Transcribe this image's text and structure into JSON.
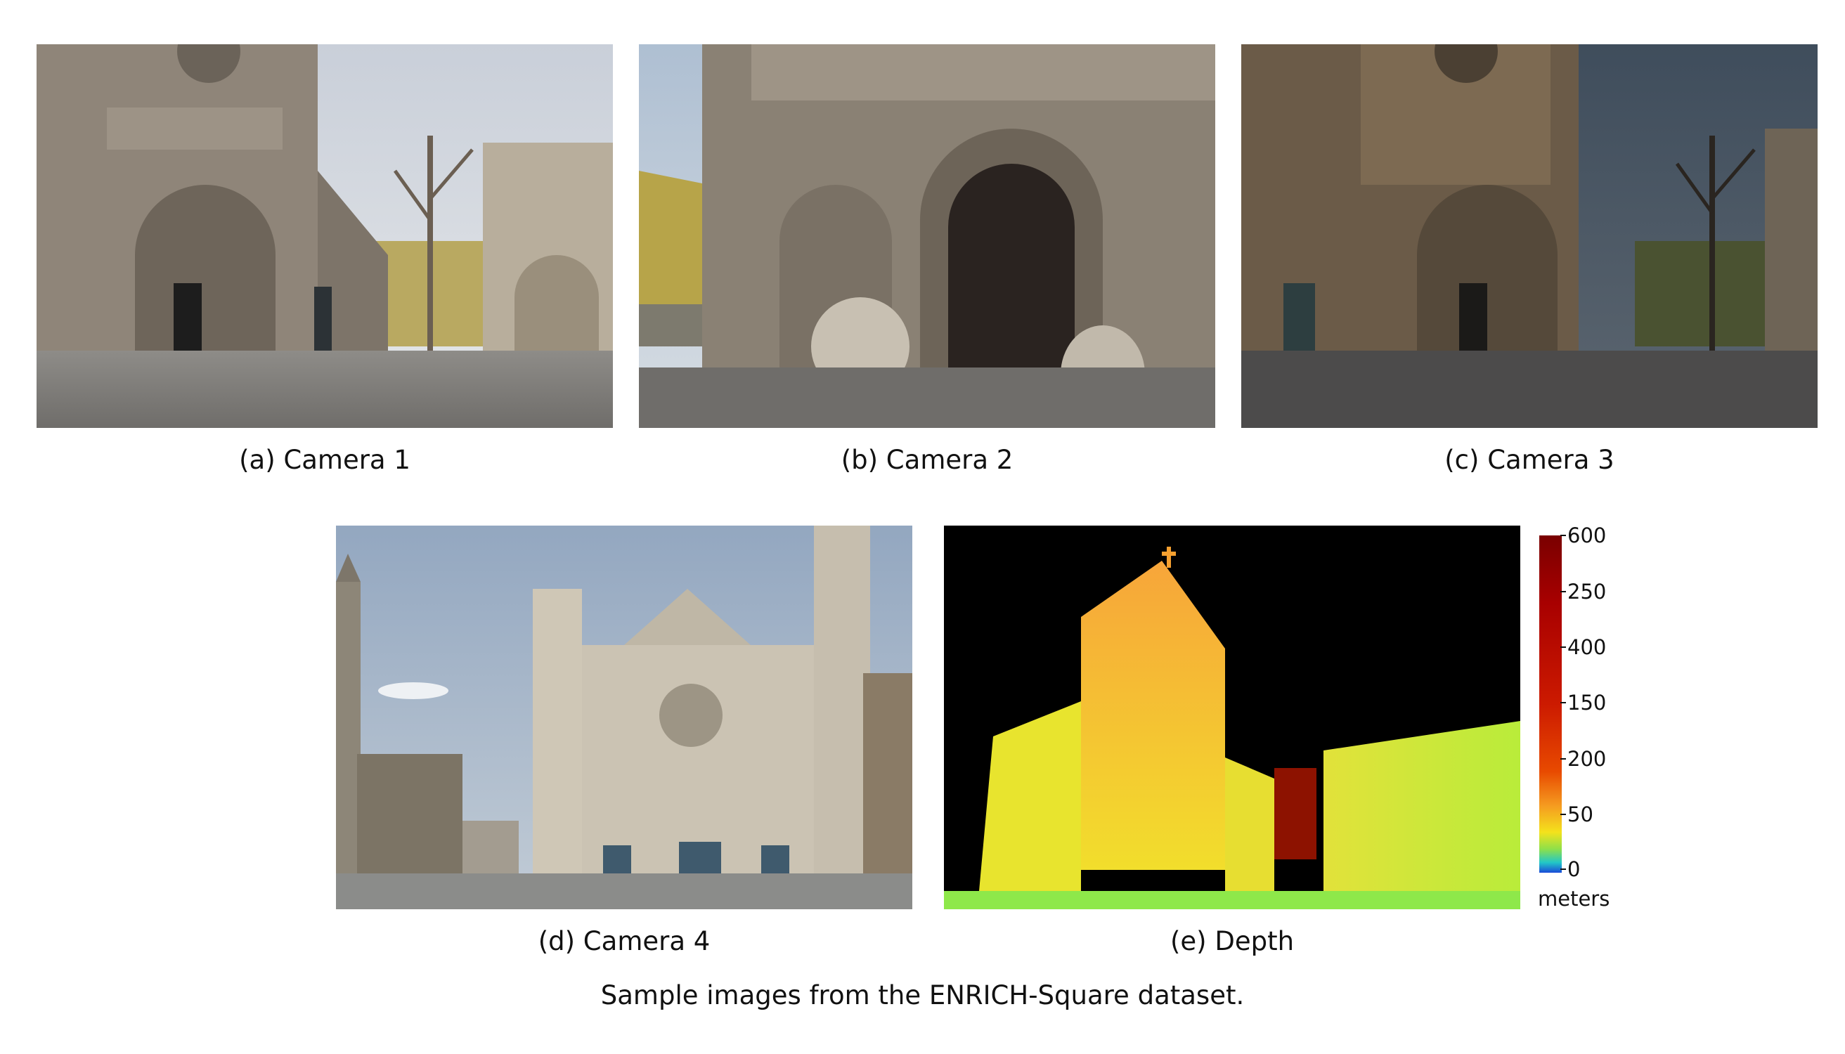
{
  "panels": [
    {
      "caption": "(a) Camera 1"
    },
    {
      "caption": "(b) Camera 2"
    },
    {
      "caption": "(c) Camera 3"
    },
    {
      "caption": "(d) Camera 4"
    },
    {
      "caption": "(e) Depth"
    }
  ],
  "colorbar": {
    "ticks": [
      "600",
      "250",
      "400",
      "150",
      "200",
      "50",
      "0"
    ],
    "unit": "meters",
    "colors": {
      "high": "#7a0000",
      "mid": "#f59a20",
      "low": "#1a4bd8"
    }
  },
  "figure_caption": "Sample images from the ENRICH-Square dataset."
}
